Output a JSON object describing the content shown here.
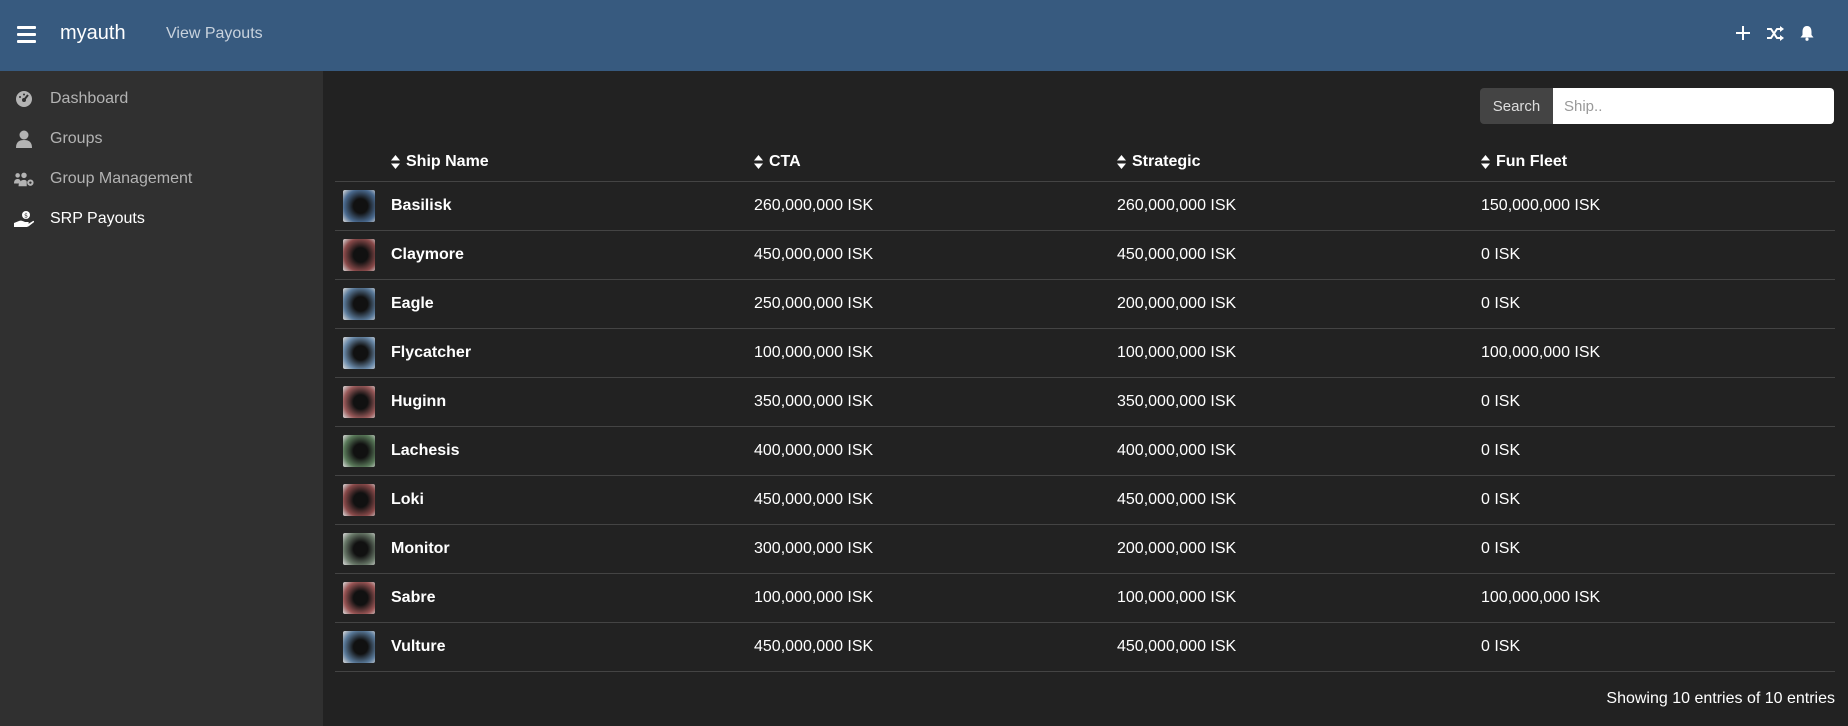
{
  "header": {
    "brand": "myauth",
    "nav_link": "View Payouts",
    "icons": [
      "menu-icon",
      "plus-icon",
      "shuffle-icon",
      "bell-icon"
    ]
  },
  "sidebar": {
    "items": [
      {
        "label": "Dashboard",
        "icon": "dashboard-icon"
      },
      {
        "label": "Groups",
        "icon": "user-icon"
      },
      {
        "label": "Group Management",
        "icon": "users-cog-icon"
      },
      {
        "label": "SRP Payouts",
        "icon": "hand-money-icon",
        "active": true
      }
    ]
  },
  "search": {
    "button_label": "Search",
    "placeholder": "Ship.."
  },
  "table": {
    "columns": [
      "Ship Name",
      "CTA",
      "Strategic",
      "Fun Fleet"
    ],
    "rows": [
      {
        "ship": "Basilisk",
        "cta": "260,000,000 ISK",
        "strategic": "260,000,000 ISK",
        "fun": "150,000,000 ISK",
        "tint": "#4a6a8f"
      },
      {
        "ship": "Claymore",
        "cta": "450,000,000 ISK",
        "strategic": "450,000,000 ISK",
        "fun": "0 ISK",
        "tint": "#8a4a4a"
      },
      {
        "ship": "Eagle",
        "cta": "250,000,000 ISK",
        "strategic": "200,000,000 ISK",
        "fun": "0 ISK",
        "tint": "#5a7a9a"
      },
      {
        "ship": "Flycatcher",
        "cta": "100,000,000 ISK",
        "strategic": "100,000,000 ISK",
        "fun": "100,000,000 ISK",
        "tint": "#6a8aaa"
      },
      {
        "ship": "Huginn",
        "cta": "350,000,000 ISK",
        "strategic": "350,000,000 ISK",
        "fun": "0 ISK",
        "tint": "#9a5a5a"
      },
      {
        "ship": "Lachesis",
        "cta": "400,000,000 ISK",
        "strategic": "400,000,000 ISK",
        "fun": "0 ISK",
        "tint": "#5a7a5a"
      },
      {
        "ship": "Loki",
        "cta": "450,000,000 ISK",
        "strategic": "450,000,000 ISK",
        "fun": "0 ISK",
        "tint": "#8a4a4a"
      },
      {
        "ship": "Monitor",
        "cta": "300,000,000 ISK",
        "strategic": "200,000,000 ISK",
        "fun": "0 ISK",
        "tint": "#6a7a6a"
      },
      {
        "ship": "Sabre",
        "cta": "100,000,000 ISK",
        "strategic": "100,000,000 ISK",
        "fun": "100,000,000 ISK",
        "tint": "#9a5555"
      },
      {
        "ship": "Vulture",
        "cta": "450,000,000 ISK",
        "strategic": "450,000,000 ISK",
        "fun": "0 ISK",
        "tint": "#5a7a9a"
      }
    ]
  },
  "footer": {
    "info": "Showing 10 entries of 10 entries"
  },
  "colors": {
    "topbar": "#375a7f",
    "sidebar": "#303030",
    "main_bg": "#222222"
  }
}
